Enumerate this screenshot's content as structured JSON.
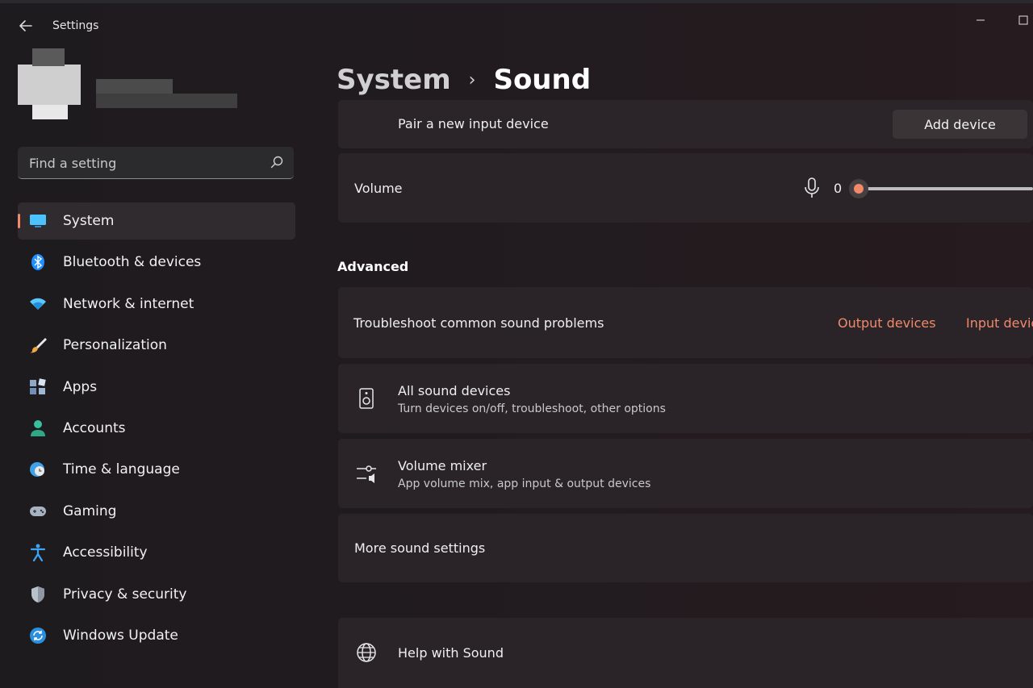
{
  "window": {
    "app_title": "Settings"
  },
  "search": {
    "placeholder": "Find a setting"
  },
  "nav": {
    "items": [
      {
        "label": "System",
        "icon": "monitor-icon"
      },
      {
        "label": "Bluetooth & devices",
        "icon": "bluetooth-icon"
      },
      {
        "label": "Network & internet",
        "icon": "wifi-icon"
      },
      {
        "label": "Personalization",
        "icon": "brush-icon"
      },
      {
        "label": "Apps",
        "icon": "apps-icon"
      },
      {
        "label": "Accounts",
        "icon": "person-icon"
      },
      {
        "label": "Time & language",
        "icon": "globe-clock-icon"
      },
      {
        "label": "Gaming",
        "icon": "gamepad-icon"
      },
      {
        "label": "Accessibility",
        "icon": "accessibility-icon"
      },
      {
        "label": "Privacy & security",
        "icon": "shield-icon"
      },
      {
        "label": "Windows Update",
        "icon": "update-icon"
      }
    ],
    "active_index": 0
  },
  "breadcrumb": {
    "parent": "System",
    "separator": "›",
    "current": "Sound"
  },
  "input": {
    "pair_label": "Pair a new input device",
    "add_device_label": "Add device",
    "volume_label": "Volume",
    "volume_value": "0",
    "volume_fraction": 0
  },
  "advanced": {
    "heading": "Advanced",
    "troubleshoot_label": "Troubleshoot common sound problems",
    "output_devices_link": "Output devices",
    "input_devices_link": "Input devices",
    "all_devices_title": "All sound devices",
    "all_devices_sub": "Turn devices on/off, troubleshoot, other options",
    "mixer_title": "Volume mixer",
    "mixer_sub": "App volume mix, app input & output devices",
    "more_settings": "More sound settings"
  },
  "help": {
    "label": "Help with Sound"
  },
  "colors": {
    "accent": "#f08a6b",
    "card": "#2a2428",
    "background": "#1e1b1e"
  }
}
